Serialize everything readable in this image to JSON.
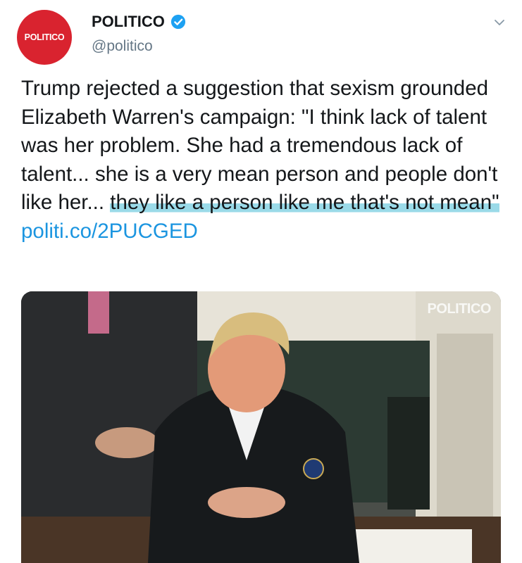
{
  "account": {
    "avatar_text": "POLITICO",
    "name": "POLITICO",
    "handle": "@politico"
  },
  "tweet": {
    "text_part1": "Trump rejected a suggestion that sexism grounded Elizabeth Warren's campaign: \"I think lack of talent was her problem. She had a tremendous lack of talent... she is a very mean person and people don't like her... ",
    "text_highlighted": "they like a person like me that's not mean\"",
    "link": "politi.co/2PUCGED"
  },
  "media": {
    "watermark": "POLITICO"
  },
  "icons": {
    "verified": "verified-badge-icon",
    "chevron": "chevron-down-icon"
  },
  "colors": {
    "brand_red": "#d9232f",
    "link_blue": "#1b95e0",
    "verified_blue": "#1da1f2",
    "highlight": "#78cde1"
  }
}
